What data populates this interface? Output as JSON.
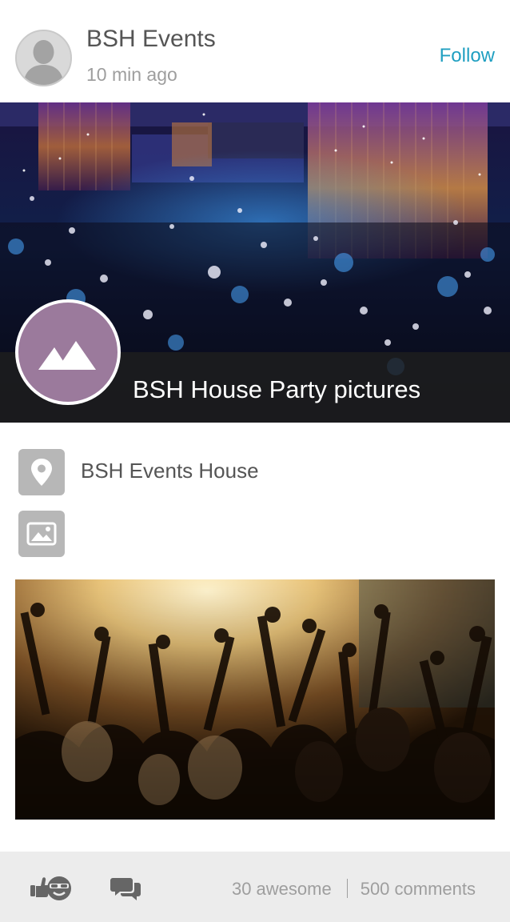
{
  "post": {
    "author": "BSH Events",
    "time": "10 min ago",
    "follow_label": "Follow"
  },
  "hero": {
    "caption": "BSH House Party pictures",
    "badge_icon": "mountains-icon",
    "badge_color": "#9b7a9c"
  },
  "details": {
    "location": "BSH Events House",
    "location_icon": "map-pin-icon",
    "media_icon": "image-icon"
  },
  "footer": {
    "awesome_count": "30 awesome",
    "comments_count": "500 comments",
    "awesome_icon": "thumbs-up-emoji-icon",
    "comment_icon": "speech-bubbles-icon"
  },
  "colors": {
    "accent": "#1f9fc1",
    "footer_bg": "#ececec",
    "icon_tile": "#b7b7b7"
  }
}
